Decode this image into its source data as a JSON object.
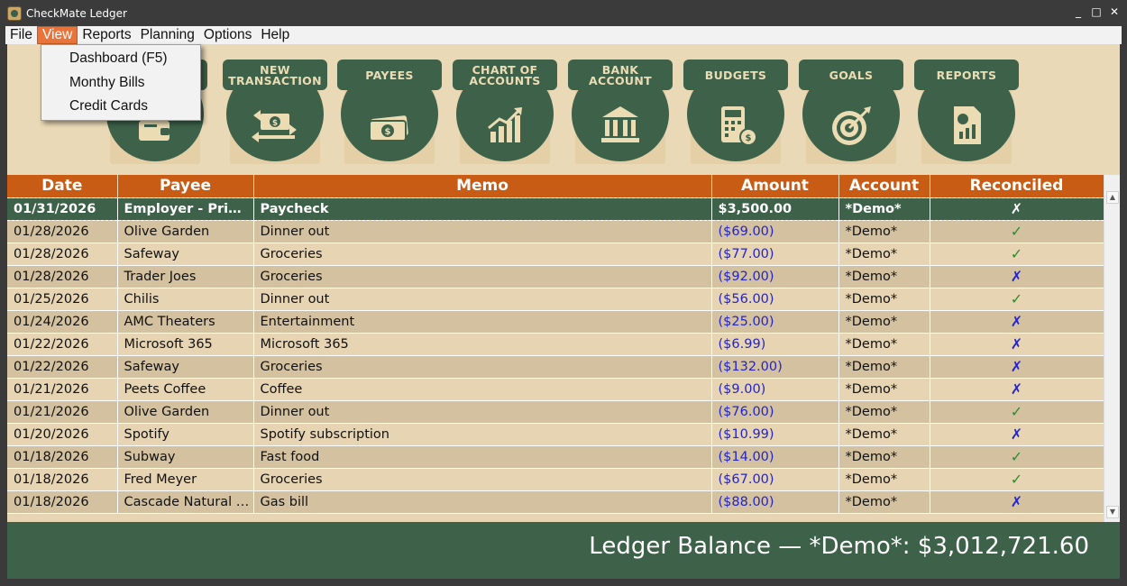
{
  "window": {
    "title": "CheckMate Ledger",
    "controls": {
      "minimize": "_",
      "maximize": "□",
      "close": "✕"
    }
  },
  "menubar": {
    "items": [
      {
        "label": "File"
      },
      {
        "label": "View"
      },
      {
        "label": "Reports"
      },
      {
        "label": "Planning"
      },
      {
        "label": "Options"
      },
      {
        "label": "Help"
      }
    ],
    "active": "View"
  },
  "dropdown": {
    "items": [
      {
        "label": "Dashboard (F5)"
      },
      {
        "label": "Monthy Bills"
      },
      {
        "label": "Credit Cards"
      }
    ]
  },
  "toolbar": {
    "buttons": [
      {
        "label": "",
        "icon": "wallet-icon"
      },
      {
        "label": "NEW\nTRANSACTION",
        "icon": "money-transfer-icon"
      },
      {
        "label": "PAYEES",
        "icon": "banknotes-icon"
      },
      {
        "label": "CHART OF\nACCOUNTS",
        "icon": "bar-chart-icon"
      },
      {
        "label": "BANK\nACCOUNT",
        "icon": "bank-icon"
      },
      {
        "label": "BUDGETS",
        "icon": "calculator-icon"
      },
      {
        "label": "GOALS",
        "icon": "target-icon"
      },
      {
        "label": "REPORTS",
        "icon": "report-icon"
      }
    ]
  },
  "table": {
    "columns": [
      "Date",
      "Payee",
      "Memo",
      "Amount",
      "Account",
      "Reconciled"
    ],
    "rows": [
      {
        "date": "01/31/2026",
        "payee": "Employer - Primary Job",
        "memo": "Paycheck",
        "amount": "$3,500.00",
        "account": "*Demo*",
        "reconciled": "✗",
        "selected": true
      },
      {
        "date": "01/28/2026",
        "payee": "Olive Garden",
        "memo": "Dinner out",
        "amount": "($69.00)",
        "account": "*Demo*",
        "reconciled": "✓"
      },
      {
        "date": "01/28/2026",
        "payee": "Safeway",
        "memo": "Groceries",
        "amount": "($77.00)",
        "account": "*Demo*",
        "reconciled": "✓"
      },
      {
        "date": "01/28/2026",
        "payee": "Trader Joes",
        "memo": "Groceries",
        "amount": "($92.00)",
        "account": "*Demo*",
        "reconciled": "✗"
      },
      {
        "date": "01/25/2026",
        "payee": "Chilis",
        "memo": "Dinner out",
        "amount": "($56.00)",
        "account": "*Demo*",
        "reconciled": "✓"
      },
      {
        "date": "01/24/2026",
        "payee": "AMC Theaters",
        "memo": "Entertainment",
        "amount": "($25.00)",
        "account": "*Demo*",
        "reconciled": "✗"
      },
      {
        "date": "01/22/2026",
        "payee": "Microsoft 365",
        "memo": "Microsoft 365",
        "amount": "($6.99)",
        "account": "*Demo*",
        "reconciled": "✗"
      },
      {
        "date": "01/22/2026",
        "payee": "Safeway",
        "memo": "Groceries",
        "amount": "($132.00)",
        "account": "*Demo*",
        "reconciled": "✗"
      },
      {
        "date": "01/21/2026",
        "payee": "Peets Coffee",
        "memo": "Coffee",
        "amount": "($9.00)",
        "account": "*Demo*",
        "reconciled": "✗"
      },
      {
        "date": "01/21/2026",
        "payee": "Olive Garden",
        "memo": "Dinner out",
        "amount": "($76.00)",
        "account": "*Demo*",
        "reconciled": "✓"
      },
      {
        "date": "01/20/2026",
        "payee": "Spotify",
        "memo": "Spotify subscription",
        "amount": "($10.99)",
        "account": "*Demo*",
        "reconciled": "✗"
      },
      {
        "date": "01/18/2026",
        "payee": "Subway",
        "memo": "Fast food",
        "amount": "($14.00)",
        "account": "*Demo*",
        "reconciled": "✓"
      },
      {
        "date": "01/18/2026",
        "payee": "Fred Meyer",
        "memo": "Groceries",
        "amount": "($67.00)",
        "account": "*Demo*",
        "reconciled": "✓"
      },
      {
        "date": "01/18/2026",
        "payee": "Cascade Natural Gas",
        "memo": "Gas bill",
        "amount": "($88.00)",
        "account": "*Demo*",
        "reconciled": "✗"
      }
    ]
  },
  "footer": {
    "balance_text": "Ledger Balance — *Demo*: $3,012,721.60"
  },
  "colors": {
    "accent_green": "#3d6149",
    "header_orange": "#c85c14",
    "menu_highlight": "#e8743b",
    "toolbar_bg": "#ead9b6",
    "amount_blue": "#2424c8",
    "check_green": "#2f8a2f"
  }
}
